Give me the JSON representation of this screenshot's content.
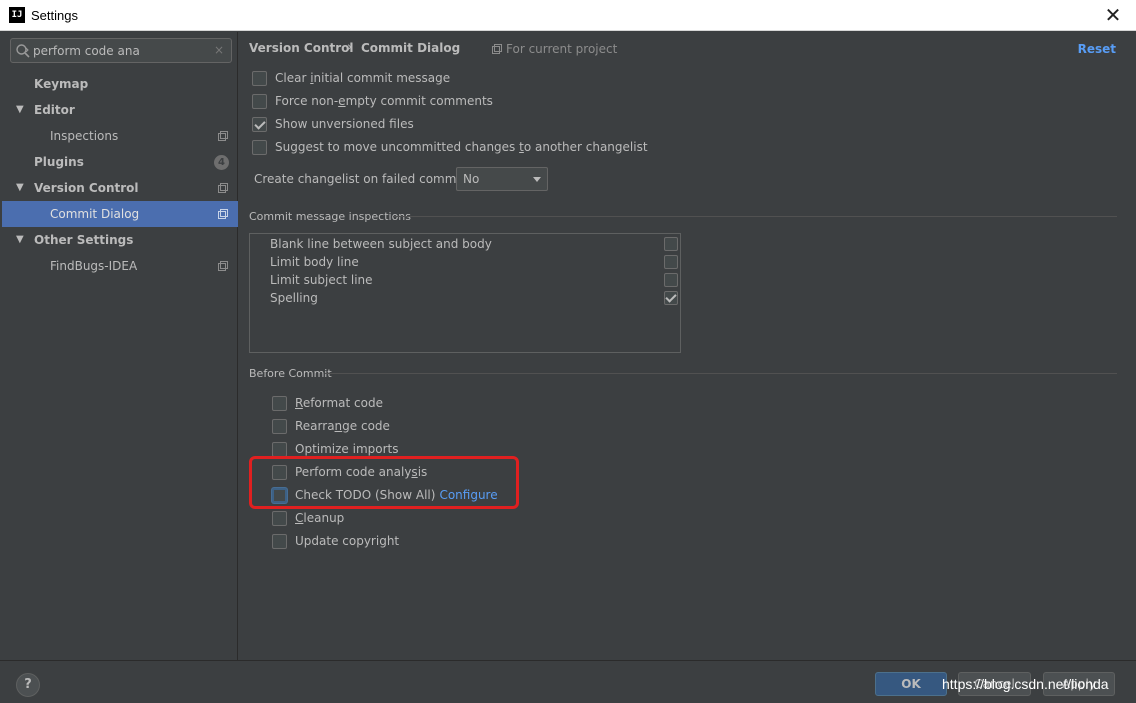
{
  "window": {
    "title": "Settings",
    "close": "✕",
    "app_icon": "intellij-icon",
    "app_icon_text": "IJ"
  },
  "search": {
    "value": "perform code ana",
    "clear": "×"
  },
  "sidebar": {
    "items": [
      {
        "label": "Keymap"
      },
      {
        "label": "Editor",
        "expanded": true
      },
      {
        "label": "Inspections",
        "project_scoped": true
      },
      {
        "label": "Plugins",
        "badge": "4"
      },
      {
        "label": "Version Control",
        "expanded": true,
        "project_scoped": true
      },
      {
        "label": "Commit Dialog",
        "selected": true,
        "project_scoped": true
      },
      {
        "label": "Other Settings",
        "expanded": true
      },
      {
        "label": "FindBugs-IDEA",
        "project_scoped": true
      }
    ]
  },
  "header": {
    "breadcrumb": [
      "Version Control",
      "Commit Dialog"
    ],
    "separator": "›",
    "scope": "For current project",
    "reset": "Reset"
  },
  "commit_options": [
    {
      "pre": "Clear ",
      "mn": "i",
      "post": "nitial commit message",
      "checked": false
    },
    {
      "pre": "Force non-",
      "mn": "e",
      "post": "mpty commit comments",
      "checked": false
    },
    {
      "pre": "Show unversioned files",
      "mn": "",
      "post": "",
      "checked": true
    },
    {
      "pre": "Suggest to move uncommitted changes ",
      "mn": "t",
      "post": "o another changelist",
      "checked": false
    }
  ],
  "changelist": {
    "label": "Create changelist on failed commit:",
    "value": "No"
  },
  "inspections": {
    "title": "Commit message inspections",
    "rows": [
      {
        "label": "Blank line between subject and body",
        "checked": false
      },
      {
        "label": "Limit body line",
        "checked": false
      },
      {
        "label": "Limit subject line",
        "checked": false
      },
      {
        "label": "Spelling",
        "checked": true
      }
    ]
  },
  "before_commit": {
    "title": "Before Commit",
    "items": [
      {
        "pre": "",
        "mn": "R",
        "post": "eformat code",
        "checked": false
      },
      {
        "pre": "Rearra",
        "mn": "n",
        "post": "ge code",
        "checked": false
      },
      {
        "pre": "Optimize imports",
        "mn": "",
        "post": "",
        "checked": false
      },
      {
        "pre": "Perform code analy",
        "mn": "s",
        "post": "is",
        "checked": false
      },
      {
        "pre": "Check TODO (Show All)",
        "mn": "",
        "post": "",
        "checked": false,
        "focused": true,
        "link": "Configure"
      },
      {
        "pre": "",
        "mn": "C",
        "post": "leanup",
        "checked": false
      },
      {
        "pre": "Update copyright",
        "mn": "",
        "post": "",
        "checked": false
      }
    ]
  },
  "footer": {
    "help": "?",
    "ok": "OK",
    "cancel": "Cancel",
    "apply": "Apply",
    "watermark": "https://blog.csdn.net/lionda"
  },
  "colors": {
    "accent": "#4b6eaf",
    "link": "#589df6",
    "highlight": "#e02020",
    "background": "#3c3f41"
  }
}
